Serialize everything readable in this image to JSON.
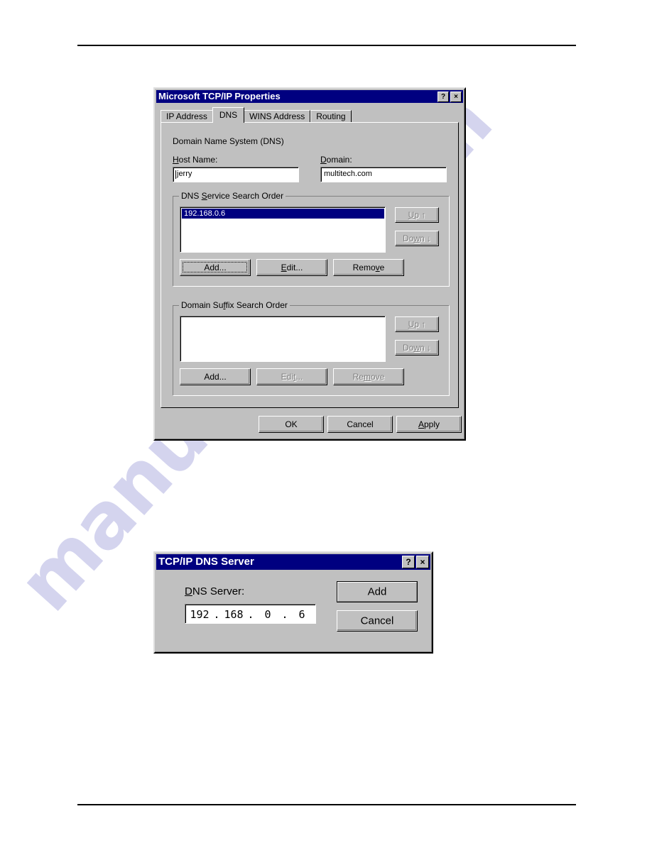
{
  "watermark": {
    "text": "manualslib.com"
  },
  "tcpip_properties": {
    "title": "Microsoft TCP/IP Properties",
    "titlebar_buttons": [
      {
        "name": "help-button",
        "glyph": "?"
      },
      {
        "name": "close-button",
        "glyph": "×"
      }
    ],
    "tabs": [
      {
        "label": "IP Address",
        "active": false
      },
      {
        "label": "DNS",
        "active": true
      },
      {
        "label": "WINS Address",
        "active": false
      },
      {
        "label": "Routing",
        "active": false
      }
    ],
    "section_title": "Domain Name System (DNS)",
    "host_name": {
      "label": "Host Name:",
      "value": "jerry"
    },
    "domain": {
      "label": "Domain:",
      "value": "multitech.com"
    },
    "dns_service_search_order": {
      "label": "DNS Service Search Order",
      "items": [
        "192.168.0.6"
      ],
      "selected_index": 0,
      "up_label": "Up",
      "down_label": "Down",
      "up_enabled": false,
      "down_enabled": false,
      "buttons": [
        {
          "label": "Add...",
          "enabled": true,
          "focused": true
        },
        {
          "label": "Edit...",
          "enabled": true,
          "focused": false
        },
        {
          "label": "Remove",
          "enabled": true,
          "focused": false
        }
      ]
    },
    "domain_suffix_search_order": {
      "label": "Domain Suffix Search Order",
      "items": [],
      "up_label": "Up",
      "down_label": "Down",
      "up_enabled": false,
      "down_enabled": false,
      "buttons": [
        {
          "label": "Add...",
          "enabled": true,
          "focused": false
        },
        {
          "label": "Edit...",
          "enabled": false,
          "focused": false
        },
        {
          "label": "Remove",
          "enabled": false,
          "focused": false
        }
      ]
    },
    "footer_buttons": [
      {
        "label": "OK"
      },
      {
        "label": "Cancel"
      },
      {
        "label": "Apply"
      }
    ]
  },
  "dns_server_dialog": {
    "title": "TCP/IP DNS Server",
    "titlebar_buttons": [
      {
        "name": "help-button",
        "glyph": "?"
      },
      {
        "name": "close-button",
        "glyph": "×"
      }
    ],
    "field_label": "DNS Server:",
    "ip_value": {
      "octet1": "192",
      "octet2": "168",
      "octet3": "0",
      "octet4": "6",
      "separator": "."
    },
    "buttons": [
      {
        "label": "Add",
        "default": true
      },
      {
        "label": "Cancel",
        "default": false
      }
    ]
  },
  "colors": {
    "face": "#c0c0c0",
    "titlebar": "#000080",
    "selection": "#000080",
    "watermark": "#9a9ad8"
  }
}
